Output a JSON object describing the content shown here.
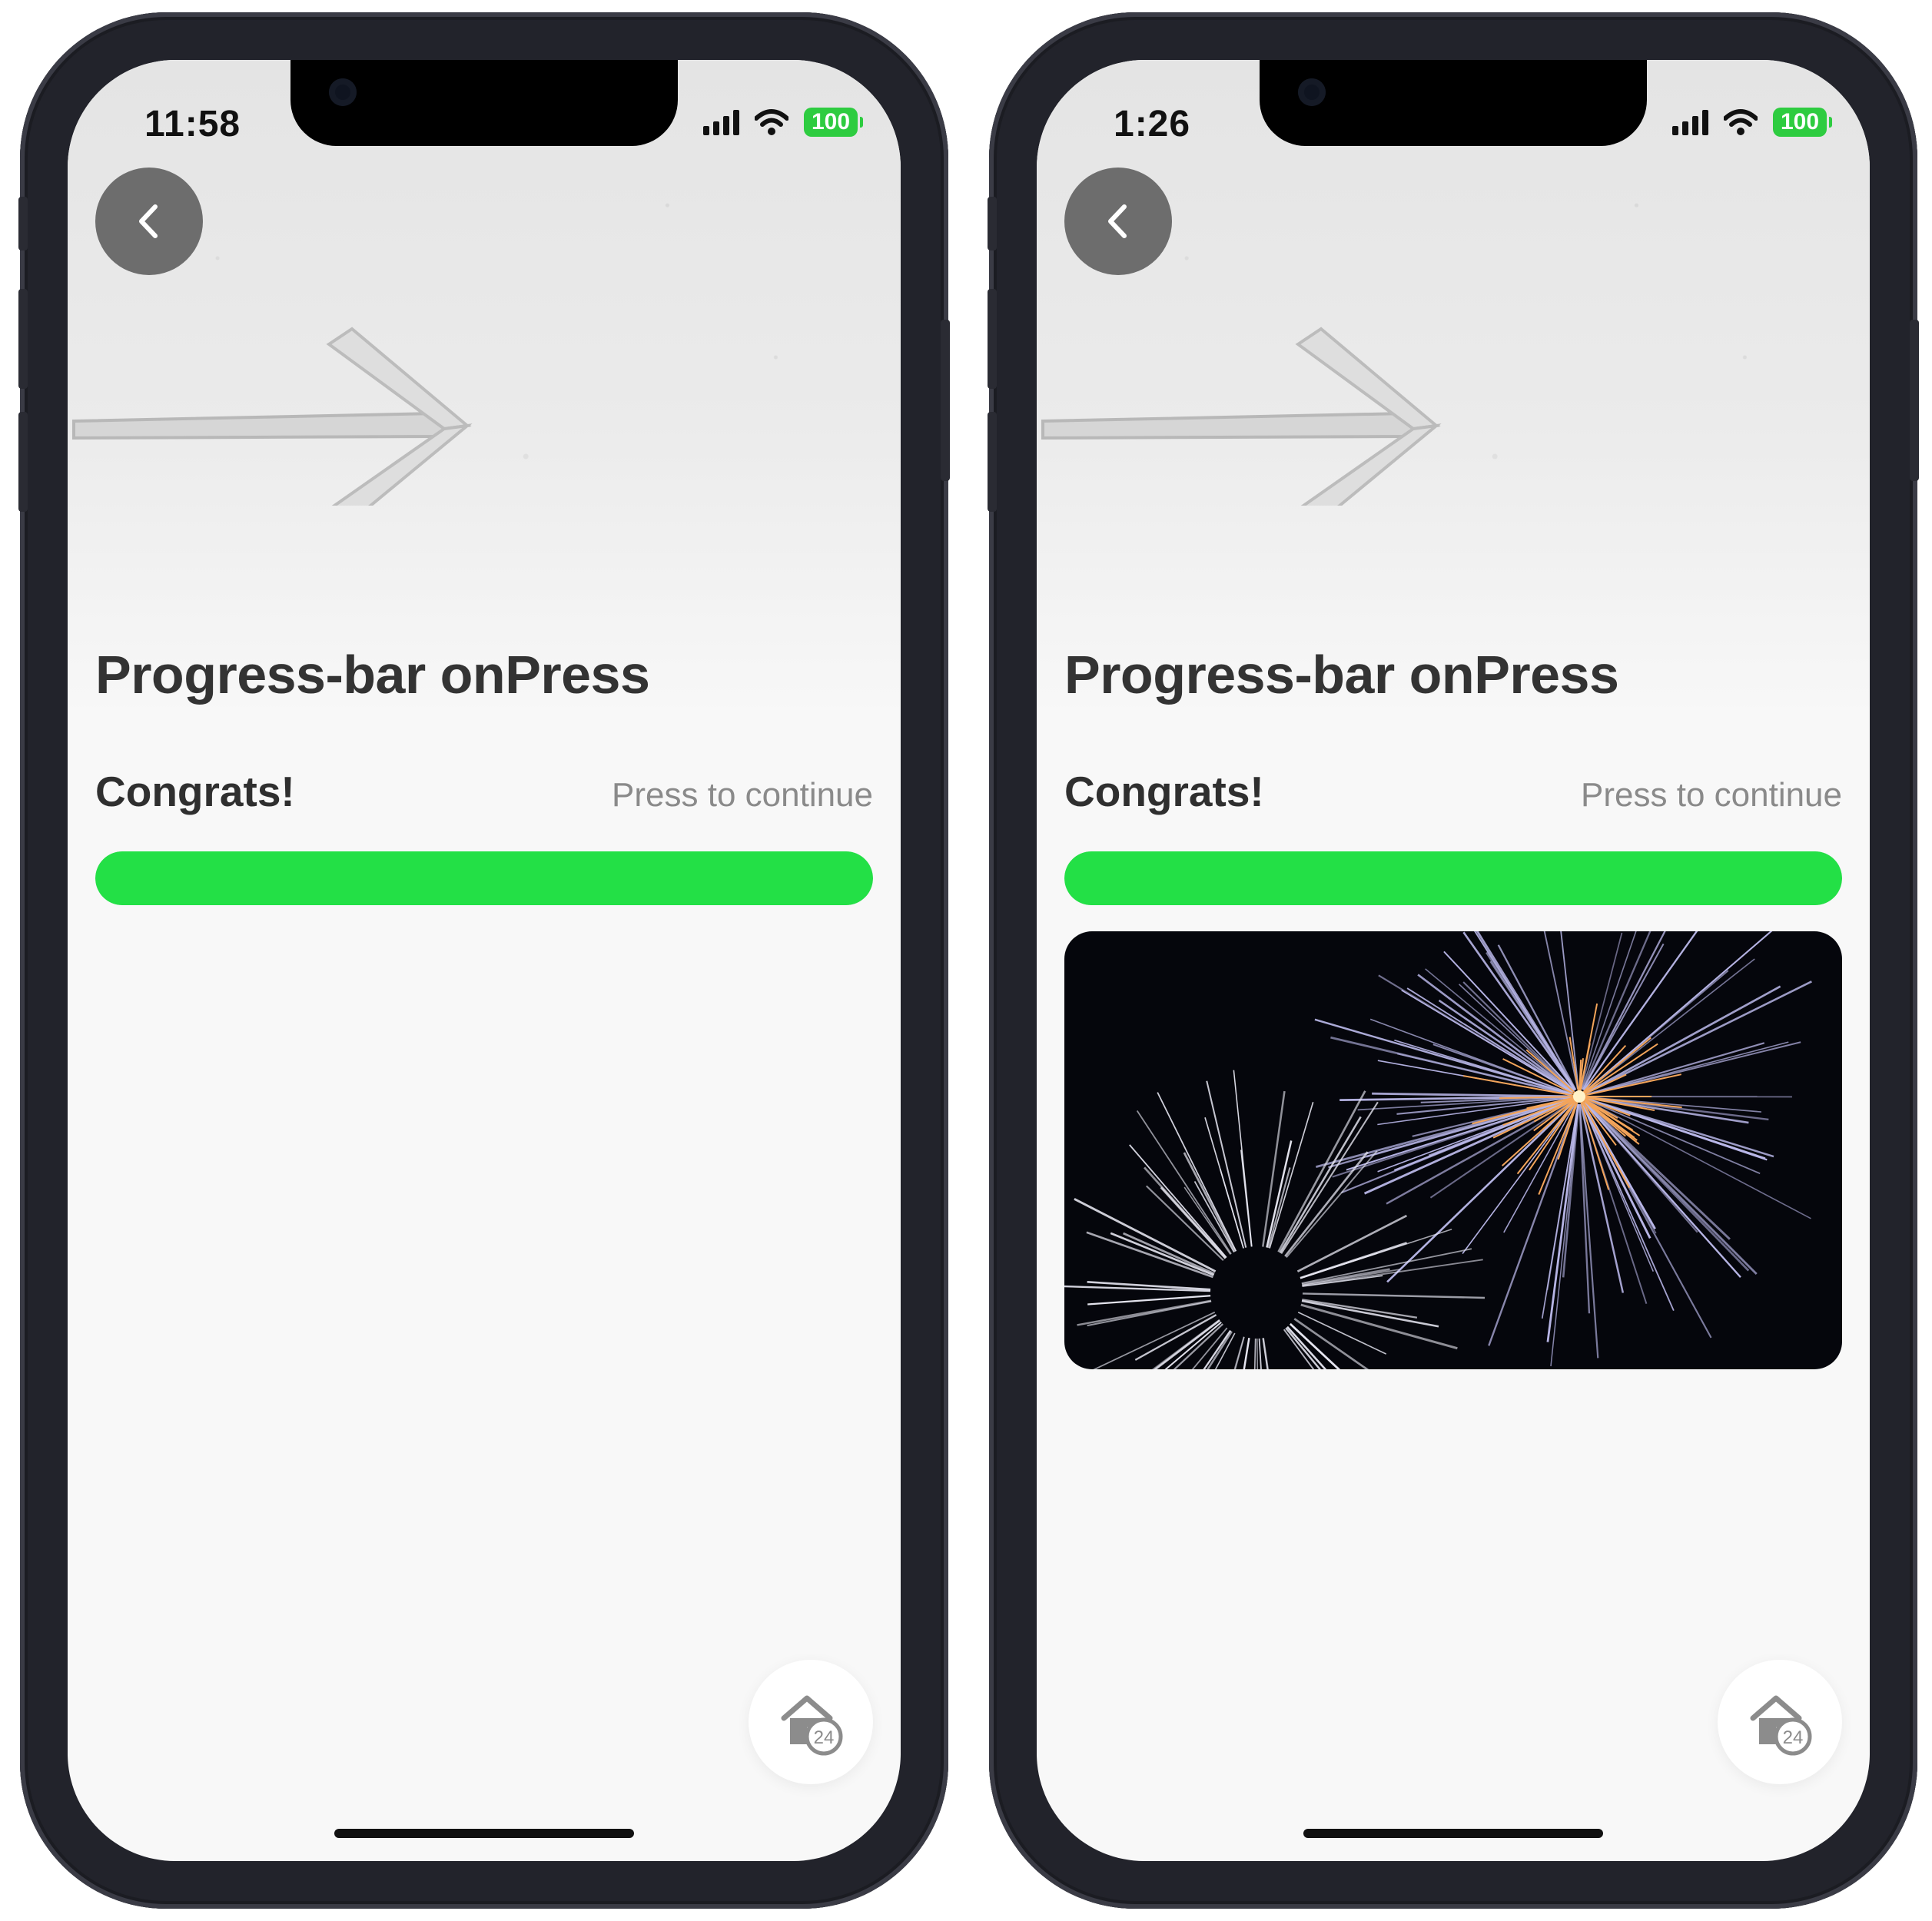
{
  "screens": [
    {
      "status_time": "11:58",
      "battery": "100",
      "title": "Progress-bar onPress",
      "progress_label": "Congrats!",
      "progress_hint": "Press to continue",
      "progress_fraction": 1.0,
      "has_fireworks_image": false,
      "fab_badge": "24"
    },
    {
      "status_time": "1:26",
      "battery": "100",
      "title": "Progress-bar onPress",
      "progress_label": "Congrats!",
      "progress_hint": "Press to continue",
      "progress_fraction": 1.0,
      "has_fireworks_image": true,
      "fab_badge": "24"
    }
  ],
  "colors": {
    "progress_fill": "#23e046",
    "battery": "#2ecc40"
  },
  "icons": {
    "back": "chevron-left-icon",
    "fab": "home-24-icon",
    "signal": "cellular-signal-icon",
    "wifi": "wifi-icon"
  }
}
